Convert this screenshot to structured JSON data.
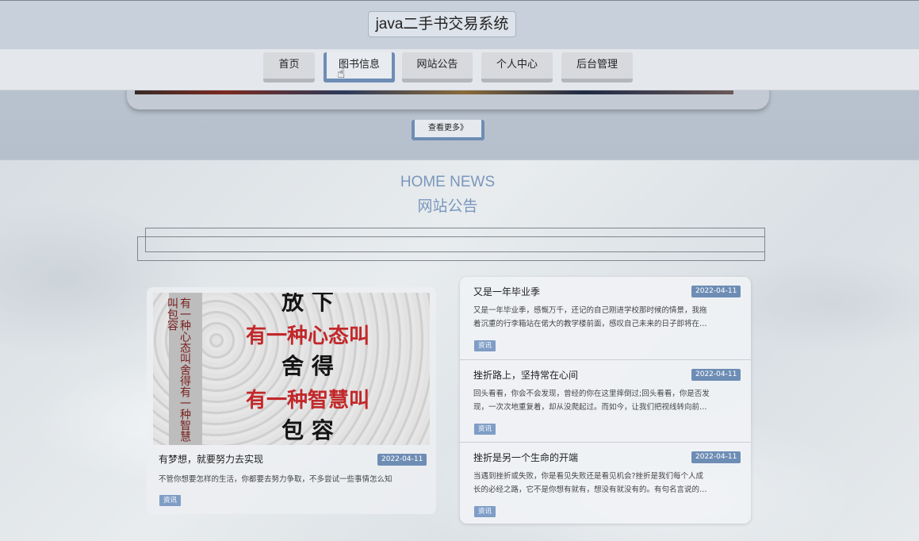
{
  "header": {
    "site_title": "java二手书交易系统"
  },
  "nav": {
    "items": [
      {
        "label": "首页"
      },
      {
        "label": "图书信息"
      },
      {
        "label": "网站公告"
      },
      {
        "label": "个人中心"
      },
      {
        "label": "后台管理"
      }
    ],
    "active_index": 1
  },
  "carousel": {
    "more_label": "查看更多》"
  },
  "news_section": {
    "title_en": "HOME NEWS",
    "title_cn": "网站公告"
  },
  "featured": {
    "image_lines": [
      "放 下",
      "有一种心态叫",
      "舍 得",
      "有一种智慧叫",
      "包 容"
    ],
    "image_spine": "有一种心态叫舍得有一种智慧叫包容",
    "title": "有梦想，就要努力去实现",
    "date": "2022-04-11",
    "desc": "不管你想要怎样的生活，你都要去努力争取，不多尝试一些事情怎么知",
    "tag": "资讯"
  },
  "news_list": [
    {
      "title": "又是一年毕业季",
      "date": "2022-04-11",
      "desc_line1": "又是一年毕业季，感慨万千，还记的自己刚进学校那时候的情景，我拖",
      "desc_line2": "着沉重的行李箱站在偌大的教学楼前面，感叹自己未来的日子即将在…",
      "tag": "资讯"
    },
    {
      "title": "挫折路上，坚持常在心间",
      "date": "2022-04-11",
      "desc_line1": "回头看看，你会不会发现，曾经的你在这里摔倒过;回头看看，你是否发",
      "desc_line2": "现，一次次地重复着，却从没爬起过。而如今，让我们把视线转向前…",
      "tag": "资讯"
    },
    {
      "title": "挫折是另一个生命的开端",
      "date": "2022-04-11",
      "desc_line1": "当遇到挫折或失败，你是看见失败还是看见机会?挫折是我们每个人成",
      "desc_line2": "长的必经之路，它不是你想有就有，想没有就没有的。有句名言说的…",
      "tag": "资讯"
    }
  ],
  "colors": {
    "accent": "#6e8db5",
    "title_blue": "#7a97bd"
  }
}
